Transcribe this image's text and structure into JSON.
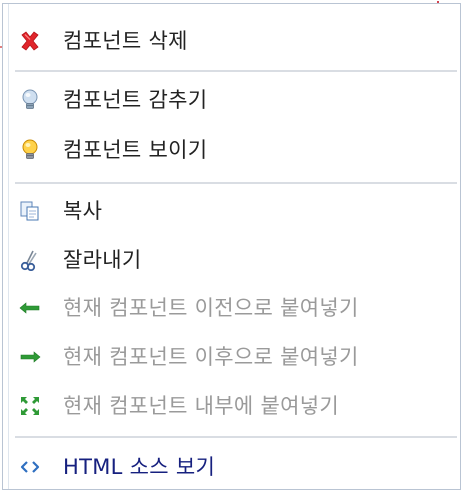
{
  "menu": {
    "items": [
      {
        "label": "컴포넌트 삭제",
        "icon": "delete-x-icon",
        "enabled": true
      },
      {
        "label": "컴포넌트 감추기",
        "icon": "bulb-off-icon",
        "enabled": true
      },
      {
        "label": "컴포넌트 보이기",
        "icon": "bulb-on-icon",
        "enabled": true
      },
      {
        "label": "복사",
        "icon": "copy-icon",
        "enabled": true
      },
      {
        "label": "잘라내기",
        "icon": "cut-scissors-icon",
        "enabled": true
      },
      {
        "label": "현재 컴포넌트 이전으로 붙여넣기",
        "icon": "arrow-left-icon",
        "enabled": false
      },
      {
        "label": "현재 컴포넌트 이후으로 붙여넣기",
        "icon": "arrow-right-icon",
        "enabled": false
      },
      {
        "label": "현재 컴포넌트 내부에 붙여넣기",
        "icon": "paste-inside-icon",
        "enabled": false
      },
      {
        "label": "HTML 소스 보기",
        "icon": "code-brackets-icon",
        "enabled": true
      }
    ]
  }
}
